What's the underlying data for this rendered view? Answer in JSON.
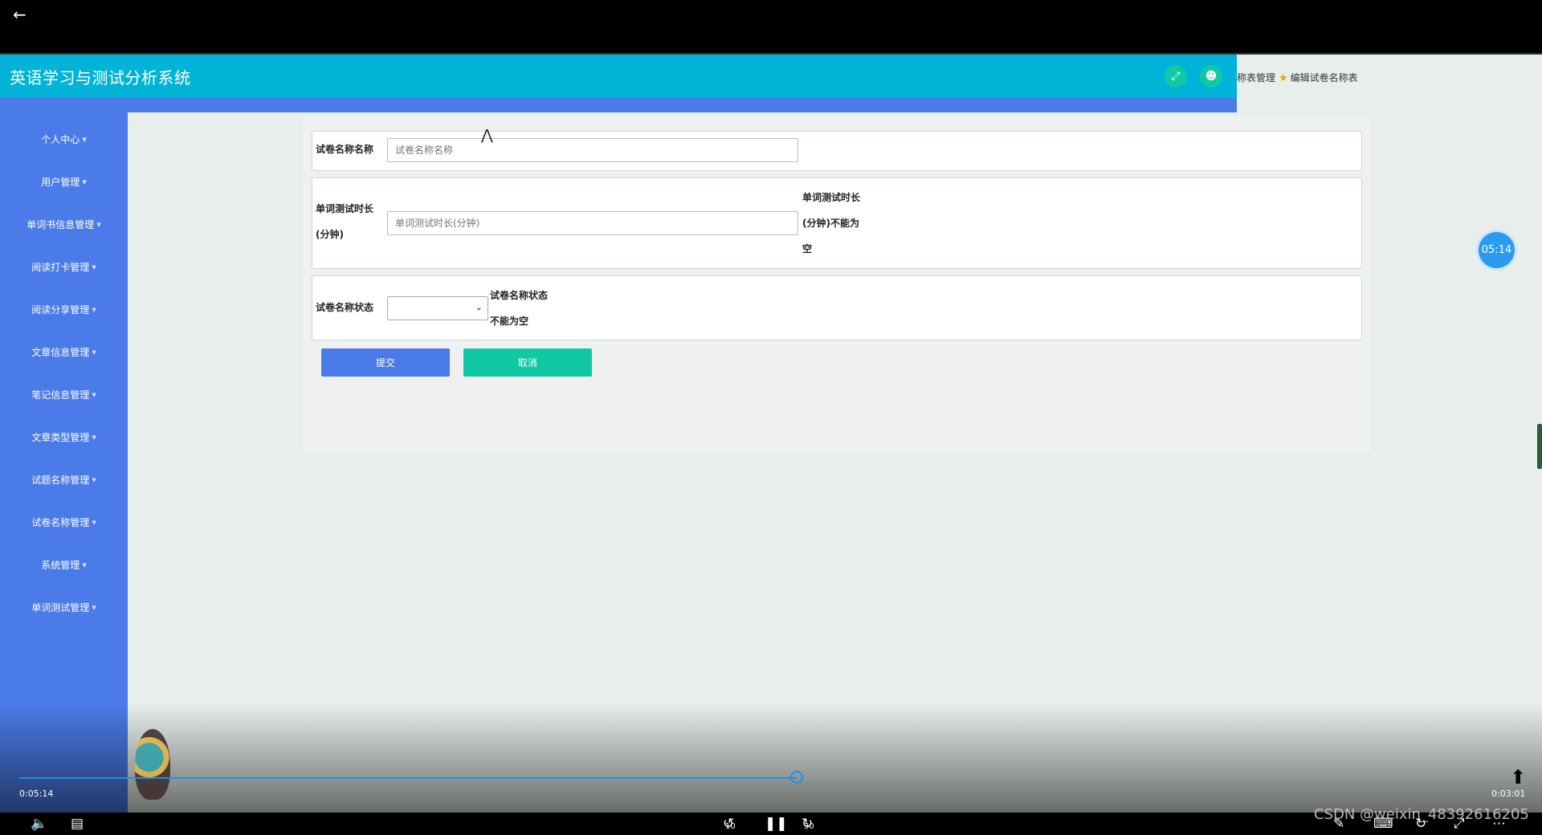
{
  "player": {
    "back_icon": "arrow-left-icon",
    "elapsed": "0:05:14",
    "remaining": "0:03:01",
    "progress_fraction": 0.515,
    "timer_badge": "05:14",
    "skip_back_label": "10",
    "skip_forward_label": "30",
    "watermark": "CSDN @weixin_48392616205"
  },
  "app": {
    "title": "英语学习与测试分析系统",
    "breadcrumb_parent": "称表管理",
    "breadcrumb_current": "编辑试卷名称表",
    "colors": {
      "header": "#00b4d8",
      "sidebar": "#4a7be8",
      "accent": "#10c9a4"
    }
  },
  "sidebar": {
    "items": [
      {
        "label": "个人中心"
      },
      {
        "label": "用户管理"
      },
      {
        "label": "单词书信息管理"
      },
      {
        "label": "阅读打卡管理"
      },
      {
        "label": "阅读分享管理"
      },
      {
        "label": "文章信息管理"
      },
      {
        "label": "笔记信息管理"
      },
      {
        "label": "文章类型管理"
      },
      {
        "label": "试题名称管理"
      },
      {
        "label": "试卷名称管理"
      },
      {
        "label": "系统管理"
      },
      {
        "label": "单词测试管理"
      }
    ]
  },
  "form": {
    "name_label": "试卷名称名称",
    "name_placeholder": "试卷名称名称",
    "duration_label_1": "单词测试时长",
    "duration_label_2": "(分钟)",
    "duration_placeholder": "单词测试时长(分钟)",
    "duration_error_1": "单词测试时长",
    "duration_error_2": "(分钟)不能为",
    "duration_error_3": "空",
    "status_label": "试卷名称状态",
    "status_error_1": "试卷名称状态",
    "status_error_2": "不能为空",
    "submit_label": "提交",
    "cancel_label": "取消"
  }
}
